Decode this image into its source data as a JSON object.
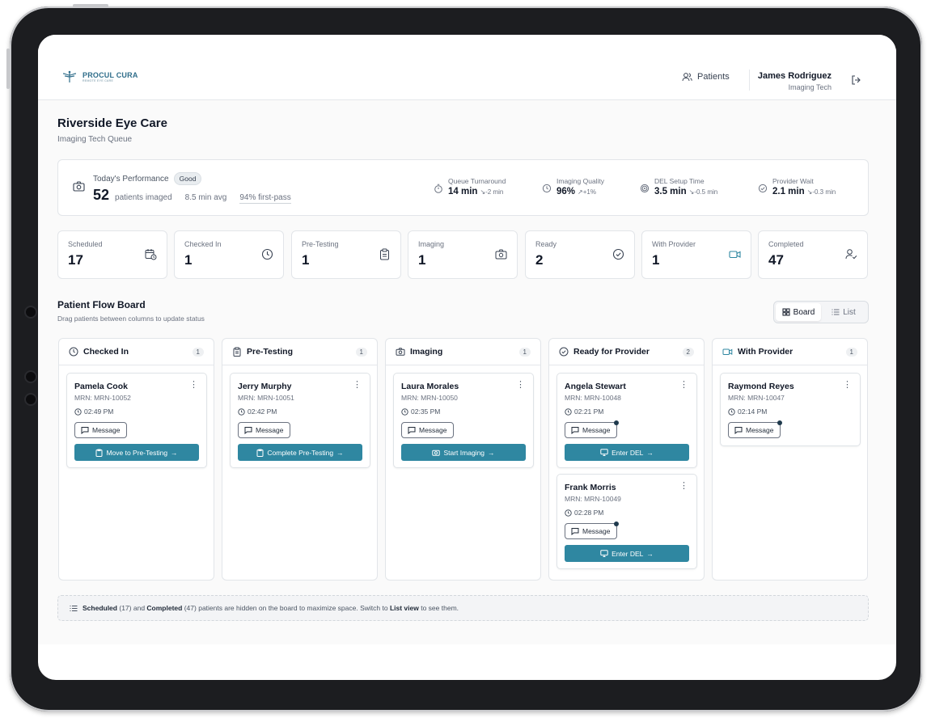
{
  "header": {
    "logo_text": "PROCUL CURA",
    "logo_tagline": "REMOTE EYE CARE",
    "nav_patients": "Patients",
    "user_name": "James Rodriguez",
    "user_role": "Imaging Tech"
  },
  "page": {
    "title": "Riverside Eye Care",
    "subtitle": "Imaging Tech Queue"
  },
  "performance": {
    "label": "Today's Performance",
    "badge": "Good",
    "count": "52",
    "count_label": "patients imaged",
    "avg": "8.5 min avg",
    "first_pass": "94% first-pass",
    "metrics": [
      {
        "label": "Queue Turnaround",
        "value": "14 min",
        "delta": "-2 min",
        "icon": "timer-icon"
      },
      {
        "label": "Imaging Quality",
        "value": "96%",
        "delta": "+1%",
        "icon": "clock-icon"
      },
      {
        "label": "DEL Setup Time",
        "value": "3.5 min",
        "delta": "-0.5 min",
        "icon": "target-icon"
      },
      {
        "label": "Provider Wait",
        "value": "2.1 min",
        "delta": "-0.3 min",
        "icon": "check-circle-icon"
      }
    ]
  },
  "stats": [
    {
      "label": "Scheduled",
      "value": "17",
      "icon": "calendar-clock-icon"
    },
    {
      "label": "Checked In",
      "value": "1",
      "icon": "clock-icon"
    },
    {
      "label": "Pre-Testing",
      "value": "1",
      "icon": "clipboard-icon"
    },
    {
      "label": "Imaging",
      "value": "1",
      "icon": "camera-icon"
    },
    {
      "label": "Ready",
      "value": "2",
      "icon": "check-circle-icon"
    },
    {
      "label": "With Provider",
      "value": "1",
      "icon": "video-icon"
    },
    {
      "label": "Completed",
      "value": "47",
      "icon": "user-check-icon"
    }
  ],
  "board": {
    "title": "Patient Flow Board",
    "subtitle": "Drag patients between columns to update status",
    "view_board": "Board",
    "view_list": "List",
    "columns": [
      {
        "title": "Checked In",
        "count": "1",
        "icon": "clock-icon",
        "cards": [
          {
            "name": "Pamela Cook",
            "mrn": "MRN: MRN-10052",
            "time": "02:49 PM",
            "message": "Message",
            "action": "Move to Pre-Testing"
          }
        ]
      },
      {
        "title": "Pre-Testing",
        "count": "1",
        "icon": "clipboard-icon",
        "cards": [
          {
            "name": "Jerry Murphy",
            "mrn": "MRN: MRN-10051",
            "time": "02:42 PM",
            "message": "Message",
            "action": "Complete Pre-Testing"
          }
        ]
      },
      {
        "title": "Imaging",
        "count": "1",
        "icon": "camera-icon",
        "cards": [
          {
            "name": "Laura Morales",
            "mrn": "MRN: MRN-10050",
            "time": "02:35 PM",
            "message": "Message",
            "action": "Start Imaging"
          }
        ]
      },
      {
        "title": "Ready for Provider",
        "count": "2",
        "icon": "check-circle-icon",
        "cards": [
          {
            "name": "Angela Stewart",
            "mrn": "MRN: MRN-10048",
            "time": "02:21 PM",
            "message": "Message",
            "action": "Enter DEL"
          },
          {
            "name": "Frank Morris",
            "mrn": "MRN: MRN-10049",
            "time": "02:28 PM",
            "message": "Message",
            "action": "Enter DEL"
          }
        ]
      },
      {
        "title": "With Provider",
        "count": "1",
        "icon": "video-icon",
        "cards": [
          {
            "name": "Raymond Reyes",
            "mrn": "MRN: MRN-10047",
            "time": "02:14 PM",
            "message": "Message"
          }
        ]
      }
    ]
  },
  "footnote": {
    "scheduled": "Scheduled",
    "scheduled_count": "(17)",
    "and": "and",
    "completed": "Completed",
    "completed_count": "(47)",
    "middle": "patients are hidden on the board to maximize space. Switch to",
    "list_view": "List view",
    "end": "to see them."
  },
  "colors": {
    "accent": "#2f87a1",
    "brand": "#2f6d8a"
  }
}
